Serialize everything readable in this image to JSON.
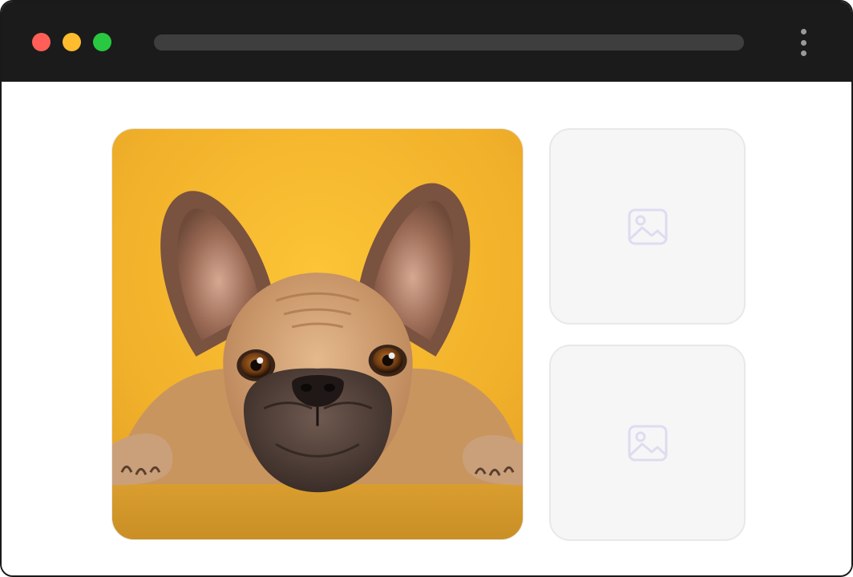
{
  "window": {
    "traffic_lights": {
      "close": "#ff5f57",
      "minimize": "#febc2e",
      "maximize": "#28c840"
    },
    "address_bar": "",
    "menu_icon": "more-vertical-icon"
  },
  "gallery": {
    "main_image": {
      "subject": "french-bulldog-photo",
      "background_color": "#f2b52a"
    },
    "placeholders": [
      {
        "icon": "image-placeholder-icon"
      },
      {
        "icon": "image-placeholder-icon"
      }
    ]
  },
  "colors": {
    "titlebar": "#1b1b1b",
    "placeholder_bg": "#f6f6f7",
    "placeholder_icon": "#dedcef"
  }
}
